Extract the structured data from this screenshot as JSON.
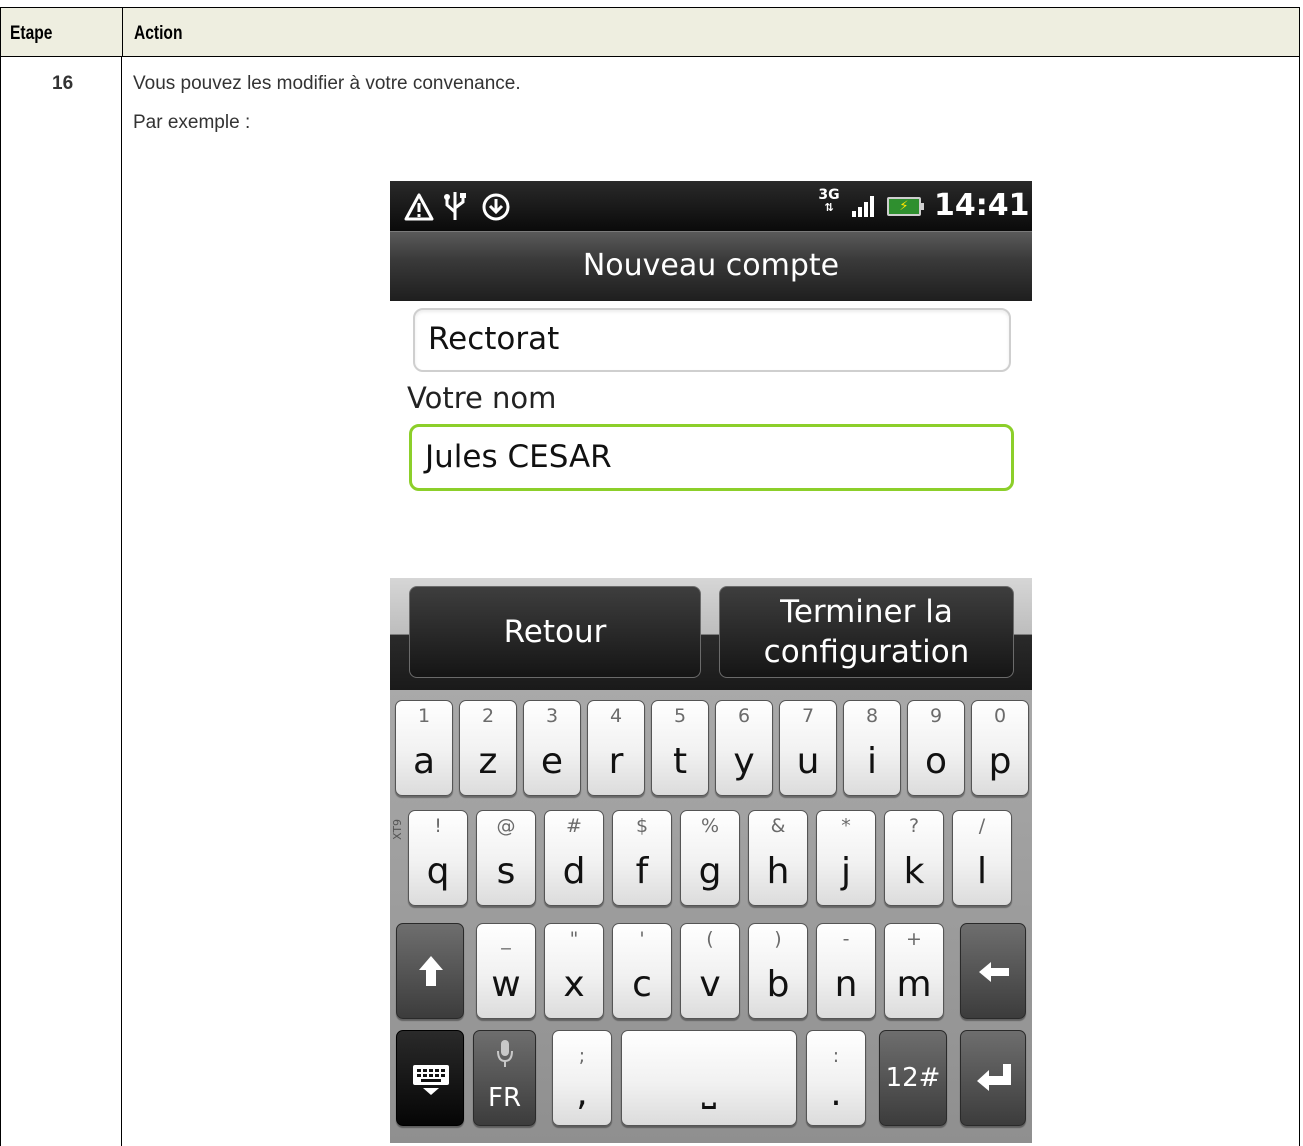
{
  "table": {
    "header": {
      "col1": "Etape",
      "col2": "Action"
    },
    "row": {
      "step": "16",
      "line1": "Vous pouvez les modifier à votre convenance.",
      "line2": "Par exemple :"
    }
  },
  "phone": {
    "status_bar": {
      "icons_left": [
        "warning-icon",
        "usb-icon",
        "download-icon"
      ],
      "network": "3G",
      "signal": "signal-bars-icon",
      "battery": "battery-charging-icon",
      "time": "14:41"
    },
    "title": "Nouveau compte",
    "account_name_value": "Rectorat",
    "your_name_label": "Votre nom",
    "your_name_value": "Jules CESAR",
    "buttons": {
      "back": "Retour",
      "finish": "Terminer la configuration"
    },
    "keyboard": {
      "side_label": "XT9",
      "row1": [
        {
          "sec": "1",
          "pri": "a"
        },
        {
          "sec": "2",
          "pri": "z"
        },
        {
          "sec": "3",
          "pri": "e"
        },
        {
          "sec": "4",
          "pri": "r"
        },
        {
          "sec": "5",
          "pri": "t"
        },
        {
          "sec": "6",
          "pri": "y"
        },
        {
          "sec": "7",
          "pri": "u"
        },
        {
          "sec": "8",
          "pri": "i"
        },
        {
          "sec": "9",
          "pri": "o"
        },
        {
          "sec": "0",
          "pri": "p"
        }
      ],
      "row2": [
        {
          "sec": "!",
          "pri": "q"
        },
        {
          "sec": "@",
          "pri": "s"
        },
        {
          "sec": "#",
          "pri": "d"
        },
        {
          "sec": "$",
          "pri": "f"
        },
        {
          "sec": "%",
          "pri": "g"
        },
        {
          "sec": "&",
          "pri": "h"
        },
        {
          "sec": "*",
          "pri": "j"
        },
        {
          "sec": "?",
          "pri": "k"
        },
        {
          "sec": "/",
          "pri": "l"
        }
      ],
      "row3": [
        {
          "sec": "_",
          "pri": "w"
        },
        {
          "sec": "\"",
          "pri": "x"
        },
        {
          "sec": "'",
          "pri": "c"
        },
        {
          "sec": "(",
          "pri": "v"
        },
        {
          "sec": ")",
          "pri": "b"
        },
        {
          "sec": "-",
          "pri": "n"
        },
        {
          "sec": "+",
          "pri": "m"
        }
      ],
      "shift_icon": "shift-arrow-icon",
      "backspace_icon": "backspace-arrow-icon",
      "keyboard_icon": "keyboard-icon",
      "mic_icon": "microphone-icon",
      "lang": "FR",
      "semicolon": ";",
      "comma": ",",
      "space": "⎵",
      "colon": ":",
      "period": ".",
      "numbers_key": "12#",
      "enter_icon": "enter-arrow-icon"
    }
  }
}
